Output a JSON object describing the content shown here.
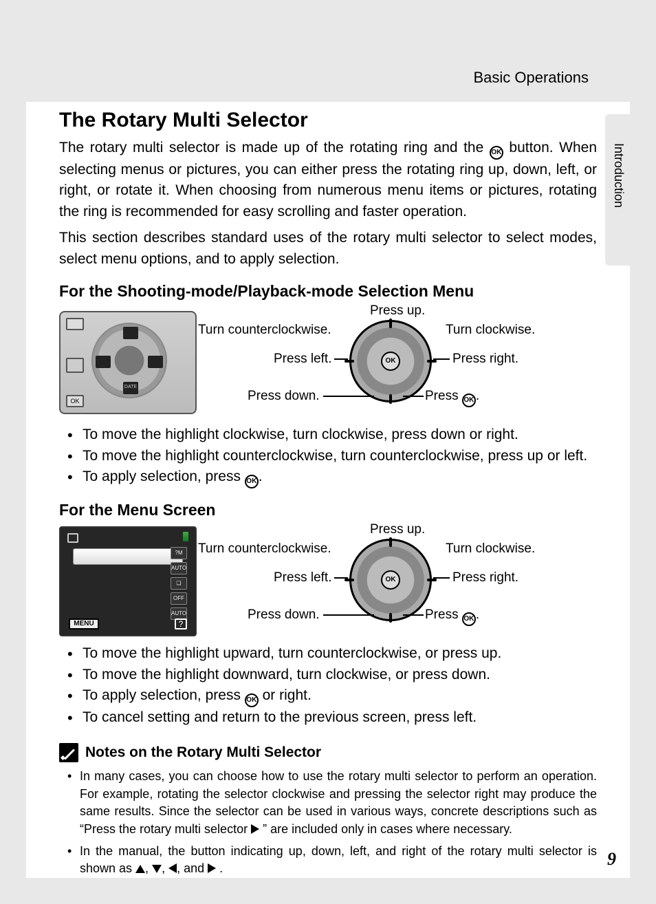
{
  "header": {
    "section": "Basic Operations",
    "tab": "Introduction"
  },
  "title": "The Rotary Multi Selector",
  "intro1_a": "The rotary multi selector is made up of the rotating ring and the ",
  "intro1_b": " button. When selecting menus or pictures, you can either press the rotating ring up, down, left, or right, or rotate it. When choosing from numerous menu items or pictures, rotating the ring is recommended for easy scrolling and faster operation.",
  "intro2": "This section describes standard uses of the rotary multi selector to select modes, select menu options, and to apply selection.",
  "sub1": "For the Shooting-mode/Playback-mode Selection Menu",
  "dial_labels": {
    "up": "Press up.",
    "cw": "Turn clockwise.",
    "ccw": "Turn counterclockwise.",
    "left": "Press left.",
    "right": "Press right.",
    "down": "Press down.",
    "ok_a": "Press ",
    "ok_b": "."
  },
  "bullets1": [
    "To move the highlight clockwise, turn clockwise, press down or right.",
    "To move the highlight counterclockwise, turn counterclockwise, press up or left.",
    "To apply selection, press "
  ],
  "sub2": "For the Menu Screen",
  "bullets2": [
    "To move the highlight upward, turn counterclockwise, or press up.",
    "To move the highlight downward, turn clockwise, or press down.",
    "To apply selection, press ",
    "To cancel setting and return to the previous screen, press left."
  ],
  "bullets2_item3_suffix": " or right.",
  "notes_title": "Notes on the Rotary Multi Selector",
  "notes": {
    "n1_a": "In many cases, you can choose how to use the rotary multi selector to perform an operation. For example, rotating the selector clockwise and pressing the selector right may produce the same results. Since the selector can be used in various ways, concrete descriptions such as “Press the rotary multi selector ",
    "n1_b": " ” are included only in cases where necessary.",
    "n2_a": "In the manual, the button indicating up, down, left, and right of the rotary multi selector is shown as ",
    "n2_b": ", ",
    "n2_c": ", ",
    "n2_d": ", and ",
    "n2_e": " ."
  },
  "thumbs": {
    "menu_label": "MENU",
    "ok_label": "OK",
    "date_label": "DATE",
    "auto_label": "AUTO",
    "off_label": "OFF"
  },
  "page_number": "9"
}
